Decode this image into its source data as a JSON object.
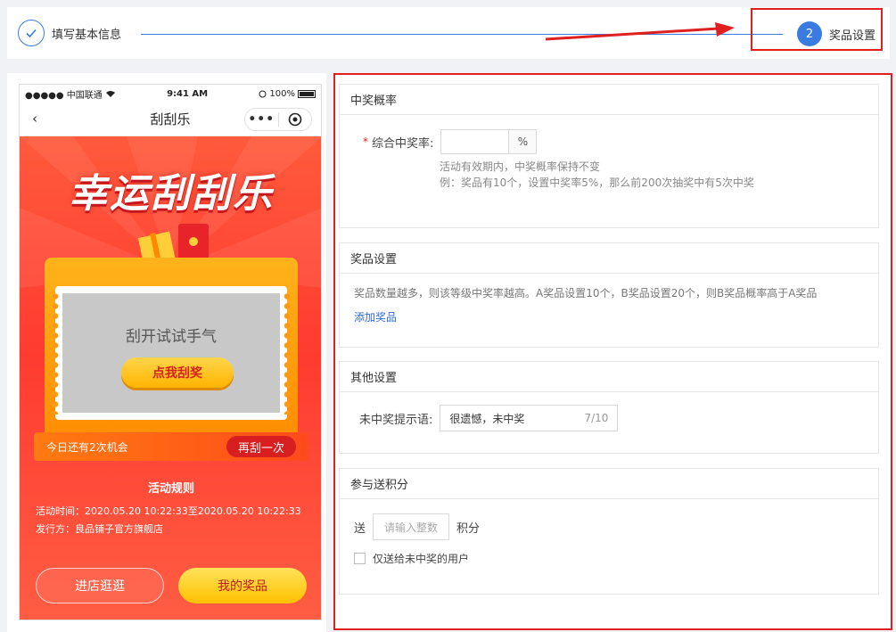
{
  "steps": {
    "step1_label": "填写基本信息",
    "step2_number": "2",
    "step2_label": "奖品设置"
  },
  "colors": {
    "primary": "#3a7be0",
    "highlight": "#e02020",
    "poster": "#ff3b30"
  },
  "phone": {
    "carrier": "●●●●● 中国联通",
    "time": "9:41 AM",
    "battery": "100%",
    "nav_title": "刮刮乐",
    "back_icon": "‹",
    "menu_icon": "•••"
  },
  "poster": {
    "headline": "幸运刮刮乐",
    "scratch_text": "刮开试试手气",
    "scratch_button": "点我刮奖",
    "chance_text": "今日还有2次机会",
    "again_button": "再刮一次",
    "rules_title": "活动规则",
    "rules_time": "活动时间：2020.05.20 10:22:33至2020.05.20 10:22:33",
    "rules_issuer": "发行方：良品铺子官方旗舰店",
    "store_button": "进店逛逛",
    "prize_button": "我的奖品"
  },
  "probability": {
    "title": "中奖概率",
    "label": "综合中奖率:",
    "required_mark": "*",
    "suffix": "%",
    "hint1": "活动有效期内，中奖概率保持不变",
    "hint2": "例：奖品有10个，设置中奖率5%，那么前200次抽奖中有5次中奖"
  },
  "prizes": {
    "title": "奖品设置",
    "desc": "奖品数量越多，则该等级中奖率越高。A奖品设置10个，B奖品设置20个，则B奖品概率高于A奖品",
    "add_link": "添加奖品"
  },
  "other": {
    "title": "其他设置",
    "label": "未中奖提示语:",
    "value": "很遗憾，未中奖",
    "count": "7/10"
  },
  "points": {
    "title": "参与送积分",
    "prefix": "送",
    "placeholder": "请输入整数",
    "suffix": "积分",
    "checkbox_label": "仅送给未中奖的用户"
  }
}
